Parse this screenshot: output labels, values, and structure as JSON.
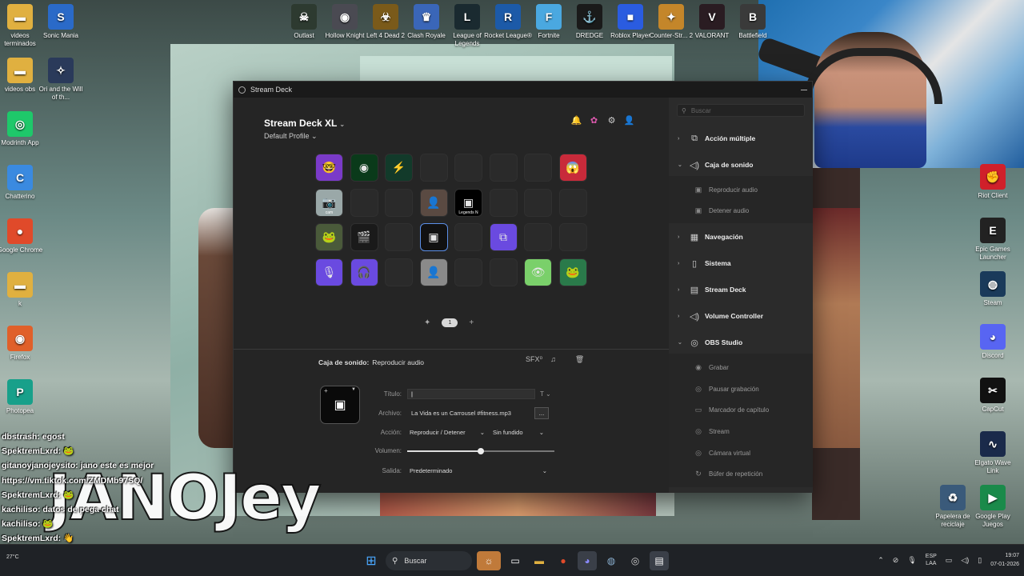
{
  "desktop": {
    "top_icons": [
      {
        "label": "Outlast",
        "color": "#2d3a30",
        "glyph": "☠"
      },
      {
        "label": "Hollow Knight",
        "color": "#4a4a52",
        "glyph": "◉"
      },
      {
        "label": "Left 4 Dead 2",
        "color": "#7a5a1a",
        "glyph": "☣"
      },
      {
        "label": "Clash Royale",
        "color": "#3a66b8",
        "glyph": "♛"
      },
      {
        "label": "League of Legends",
        "color": "#1a2a30",
        "glyph": "L"
      },
      {
        "label": "Rocket League®",
        "color": "#1c5aa8",
        "glyph": "R"
      },
      {
        "label": "Fortnite",
        "color": "#4aa8e0",
        "glyph": "F"
      },
      {
        "label": "DREDGE",
        "color": "#1a1a1a",
        "glyph": "⚓"
      },
      {
        "label": "Roblox Player",
        "color": "#2a5ce0",
        "glyph": "■"
      },
      {
        "label": "Counter-Str... 2",
        "color": "#c4862a",
        "glyph": "✦"
      },
      {
        "label": "VALORANT",
        "color": "#2a1c22",
        "glyph": "V"
      },
      {
        "label": "Battlefield",
        "color": "#3a3a3a",
        "glyph": "B"
      }
    ],
    "left_icons": [
      {
        "label": "videos terminados",
        "color": "#e0b040",
        "glyph": "▬"
      },
      {
        "label": "Sonic Mania",
        "color": "#2a6ac8",
        "glyph": "S"
      },
      {
        "label": "videos obs",
        "color": "#e0b040",
        "glyph": "▬"
      },
      {
        "label": "Ori and the Will of th...",
        "color": "#2a3a5a",
        "glyph": "✧"
      },
      {
        "label": "Modrinth App",
        "color": "#1ec86a",
        "glyph": "◎"
      },
      {
        "label": "Chatterino",
        "color": "#3a8ae0",
        "glyph": "C"
      },
      {
        "label": "Google Chrome",
        "color": "#e04a2a",
        "glyph": "●"
      },
      {
        "label": "k",
        "color": "#e0b040",
        "glyph": "▬"
      },
      {
        "label": "Firefox",
        "color": "#e0602a",
        "glyph": "◉"
      },
      {
        "label": "Photopea",
        "color": "#18a08a",
        "glyph": "P"
      }
    ],
    "right_icons": [
      {
        "label": "Riot Client",
        "color": "#d0202a",
        "glyph": "✊"
      },
      {
        "label": "Epic Games Launcher",
        "color": "#222222",
        "glyph": "E"
      },
      {
        "label": "Steam",
        "color": "#1a3a5a",
        "glyph": "◍"
      },
      {
        "label": "Discord",
        "color": "#5865f2",
        "glyph": "◕"
      },
      {
        "label": "CapCut",
        "color": "#111111",
        "glyph": "✂"
      },
      {
        "label": "Elgato Wave Link",
        "color": "#1a2a4a",
        "glyph": "∿"
      },
      {
        "label": "Papelera de reciclaje",
        "color": "#3a5a7a",
        "glyph": "♻"
      },
      {
        "label": "Google Play Juegos",
        "color": "#1a8a4a",
        "glyph": "▶"
      }
    ]
  },
  "window": {
    "title": "Stream Deck"
  },
  "deck": {
    "device": "Stream Deck XL",
    "profile": "Default Profile",
    "page_number": "1",
    "keys": [
      {
        "glyph": "🤓",
        "bg": "#7a3ac8"
      },
      {
        "glyph": "◉",
        "bg": "#0a3a1a"
      },
      {
        "glyph": "⚡",
        "bg": "#123a2a"
      },
      {
        "glyph": "",
        "bg": ""
      },
      {
        "glyph": "",
        "bg": ""
      },
      {
        "glyph": "",
        "bg": ""
      },
      {
        "glyph": "",
        "bg": ""
      },
      {
        "glyph": "😱",
        "bg": "#c82a3a"
      },
      {
        "glyph": "📷",
        "bg": "#9aa8a8",
        "tag": "cam"
      },
      {
        "glyph": "",
        "bg": ""
      },
      {
        "glyph": "",
        "bg": ""
      },
      {
        "glyph": "👤",
        "bg": "#5a4a42"
      },
      {
        "glyph": "▣",
        "bg": "#000000",
        "tag": "Legends N"
      },
      {
        "glyph": "",
        "bg": ""
      },
      {
        "glyph": "",
        "bg": ""
      },
      {
        "glyph": "",
        "bg": ""
      },
      {
        "glyph": "🐸",
        "bg": "#4a5a3a"
      },
      {
        "glyph": "🎬",
        "bg": "#1a1a1a"
      },
      {
        "glyph": "",
        "bg": ""
      },
      {
        "glyph": "▣",
        "bg": "#111111",
        "selected": true
      },
      {
        "glyph": "",
        "bg": ""
      },
      {
        "glyph": "⧉",
        "bg": "#6a4ae0"
      },
      {
        "glyph": "",
        "bg": ""
      },
      {
        "glyph": "",
        "bg": ""
      },
      {
        "glyph": "🎙",
        "bg": "#6a4ae0"
      },
      {
        "glyph": "🎧",
        "bg": "#6a4ae0"
      },
      {
        "glyph": "",
        "bg": ""
      },
      {
        "glyph": "👤",
        "bg": "#8a8a8a"
      },
      {
        "glyph": "",
        "bg": ""
      },
      {
        "glyph": "",
        "bg": ""
      },
      {
        "glyph": "👁",
        "bg": "#7ad06a"
      },
      {
        "glyph": "🐸",
        "bg": "#2a7a4a"
      }
    ]
  },
  "properties": {
    "category": "Caja de sonido:",
    "action": "Reproducir audio",
    "sfx_label": "SFX",
    "title_label": "Título:",
    "title_value": "",
    "file_label": "Archivo:",
    "file_value": "La Vida es un Carrousel #fitness.mp3",
    "browse_label": "...",
    "action_label": "Acción:",
    "action_value": "Reproducir / Detener",
    "fade_value": "Sin fundido",
    "volume_label": "Volumen:",
    "volume_level": 0.5,
    "output_label": "Salida:",
    "output_value": "Predeterminado"
  },
  "sidebar": {
    "search_placeholder": "Buscar",
    "categories": [
      {
        "label": "Acción múltiple",
        "icon": "⧉",
        "open": false,
        "subs": []
      },
      {
        "label": "Caja de sonido",
        "icon": "◁)",
        "open": true,
        "subs": [
          {
            "label": "Reproducir audio",
            "icon": "▣"
          },
          {
            "label": "Detener audio",
            "icon": "▣"
          }
        ]
      },
      {
        "label": "Navegación",
        "icon": "▦",
        "open": false,
        "subs": []
      },
      {
        "label": "Sistema",
        "icon": "▯",
        "open": false,
        "subs": []
      },
      {
        "label": "Stream Deck",
        "icon": "▤",
        "open": false,
        "subs": []
      },
      {
        "label": "Volume Controller",
        "icon": "◁)",
        "open": false,
        "subs": []
      },
      {
        "label": "OBS Studio",
        "icon": "◎",
        "open": true,
        "subs": [
          {
            "label": "Grabar",
            "icon": "◉"
          },
          {
            "label": "Pausar grabación",
            "icon": "◎"
          },
          {
            "label": "Marcador de capítulo",
            "icon": "▭"
          },
          {
            "label": "Stream",
            "icon": "◎"
          },
          {
            "label": "Cámara virtual",
            "icon": "◎"
          },
          {
            "label": "Búfer de repetición",
            "icon": "↻"
          }
        ]
      }
    ]
  },
  "chat": {
    "lines": [
      {
        "user": "dbstrash",
        "text": "egost"
      },
      {
        "user": "SpektremLxrd",
        "text": "🐸"
      },
      {
        "user": "gitanoyjanojeysito",
        "text": "jano este es mejor"
      },
      {
        "user": "",
        "text": "https://vm.tiktok.com/ZMDMb97SQ/"
      },
      {
        "user": "SpektremLxrd",
        "text": "🐸"
      },
      {
        "user": "kachiliso",
        "text": "datos de pega chat"
      },
      {
        "user": "kachiliso",
        "text": "🐸"
      },
      {
        "user": "SpektremLxrd",
        "text": "👋"
      },
      {
        "user": "SpektremLxrd",
        "text": "👋"
      }
    ],
    "banner": "JANOJey"
  },
  "taskbar": {
    "search_label": "Buscar",
    "weather": "27°C",
    "lang_1": "ESP",
    "lang_2": "LAA",
    "time": "19:07",
    "date": "07-01-2026"
  }
}
